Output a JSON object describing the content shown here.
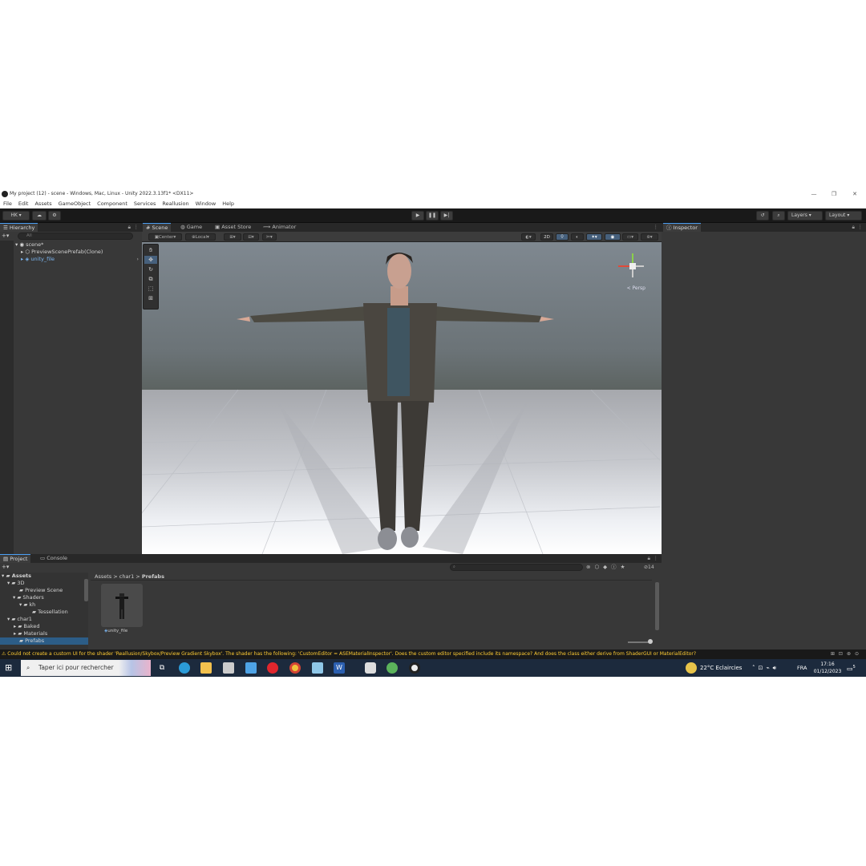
{
  "window": {
    "title": "My project (12) - scene - Windows, Mac, Linux - Unity 2022.3.13f1* <DX11>",
    "minimize": "—",
    "restore": "❐",
    "close": "✕"
  },
  "menu": [
    "File",
    "Edit",
    "Assets",
    "GameObject",
    "Component",
    "Services",
    "Reallusion",
    "Window",
    "Help"
  ],
  "toolbar": {
    "account": "HK ▾",
    "cloud": "☁",
    "settings": "⚙",
    "play": "▶",
    "pause": "❚❚",
    "step": "▶|",
    "history": "↺",
    "search": "⌕",
    "layers": "Layers",
    "layout": "Layout"
  },
  "hierarchy": {
    "title": "Hierarchy",
    "search_placeholder": "All",
    "items": [
      {
        "label": "scene*",
        "depth": 0
      },
      {
        "label": "PreviewScenePrefab(Clone)",
        "depth": 1
      },
      {
        "label": "unity_file",
        "depth": 1
      }
    ]
  },
  "scene_tabs": [
    {
      "label": "Scene",
      "active": true,
      "icon": "grid-icon"
    },
    {
      "label": "Game",
      "active": false,
      "icon": "gamepad-icon"
    },
    {
      "label": "Asset Store",
      "active": false,
      "icon": "bag-icon"
    },
    {
      "label": "Animator",
      "active": false,
      "icon": "animator-icon"
    }
  ],
  "scene_toolbar": {
    "pivot": "Center",
    "space": "Local",
    "mode_2d": "2D",
    "persp": "< Persp"
  },
  "inspector": {
    "title": "Inspector"
  },
  "project": {
    "tabs": [
      "Project",
      "Console"
    ],
    "breadcrumb": [
      "Assets",
      "char1",
      "Prefabs"
    ],
    "tree": [
      {
        "label": "Assets",
        "depth": 0
      },
      {
        "label": "3D",
        "depth": 1
      },
      {
        "label": "Preview Scene",
        "depth": 2
      },
      {
        "label": "Shaders",
        "depth": 2
      },
      {
        "label": "kh",
        "depth": 3
      },
      {
        "label": "Tessellation",
        "depth": 4
      },
      {
        "label": "char1",
        "depth": 1
      },
      {
        "label": "Baked",
        "depth": 2
      },
      {
        "label": "Materials",
        "depth": 2
      },
      {
        "label": "Prefabs",
        "depth": 2
      }
    ],
    "asset_label": "unity_file",
    "hidden_count": "14"
  },
  "status": {
    "message": "⚠ Could not create a custom UI for the shader 'Reallusion/Skybox/Preview Gradient Skybox'. The shader has the following: 'CustomEditor = ASEMaterialInspector'. Does the custom editor specified include its namespace? And does the class either derive from ShaderGUI or MaterialEditor?"
  },
  "taskbar": {
    "search_placeholder": "Taper ici pour rechercher",
    "weather": "22°C  Eclaircies",
    "language": "FRA",
    "time": "17:16",
    "date": "01/12/2023",
    "notification": "5"
  },
  "colors": {
    "accent": "#4a9ff5",
    "warning": "#ffcc33",
    "taskbar": "#1c2a3d"
  }
}
